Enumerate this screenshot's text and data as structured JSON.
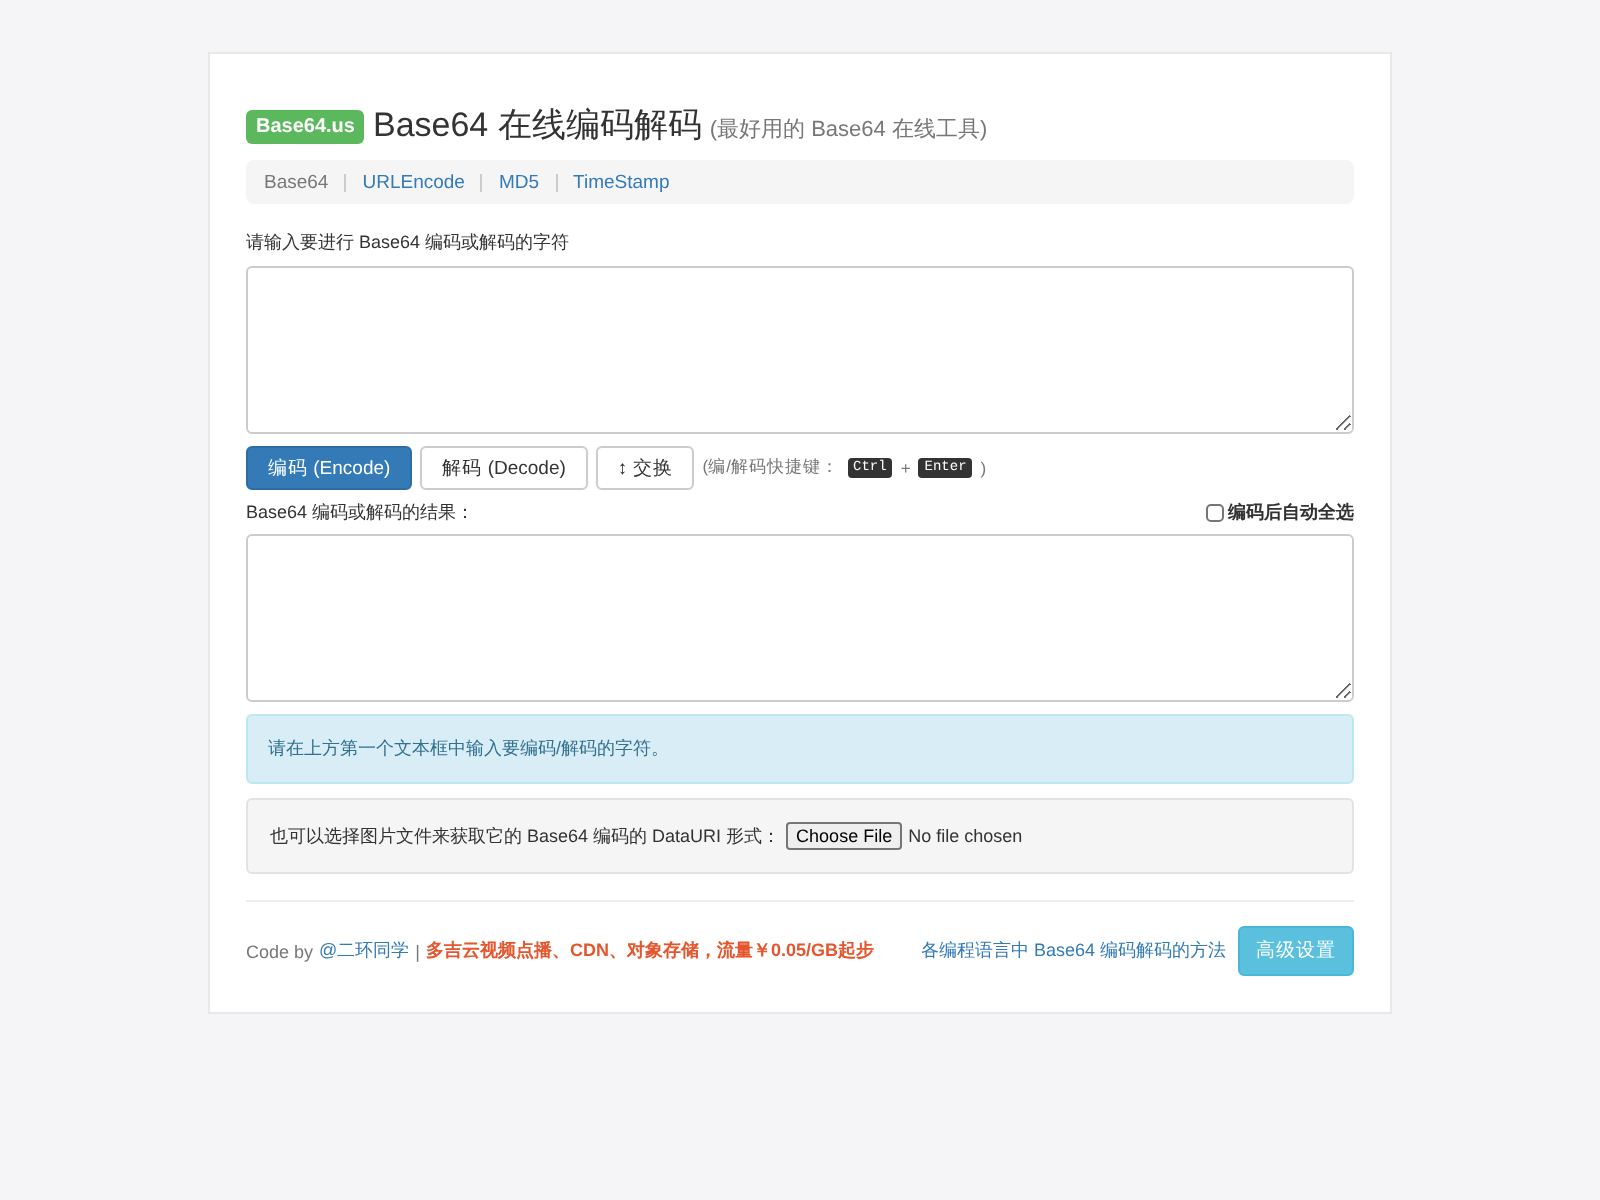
{
  "header": {
    "badge": "Base64.us",
    "title": "Base64 在线编码解码",
    "subtitle": "(最好用的 Base64 在线工具)"
  },
  "nav": [
    {
      "label": "Base64",
      "selected": true
    },
    {
      "label": "URLEncode",
      "selected": false
    },
    {
      "label": "MD5",
      "selected": false
    },
    {
      "label": "TimeStamp",
      "selected": false
    }
  ],
  "input": {
    "label": "请输入要进行 Base64 编码或解码的字符"
  },
  "buttons": [
    {
      "label": "编码 (Encode)",
      "kind": "primary"
    },
    {
      "label": "解码 (Decode)",
      "kind": "default"
    },
    {
      "label": "↕ 交换",
      "kind": "default"
    }
  ],
  "shortcut": {
    "prefix": "(编/解码快捷键：",
    "key1": "Ctrl",
    "plus": "+",
    "key2": "Enter",
    "suffix": ")"
  },
  "result": {
    "label": "Base64 编码或解码的结果：",
    "auto_select": {
      "label": "编码后自动全选",
      "checked": false
    }
  },
  "alert": "请在上方第一个文本框中输入要编码/解码的字符。",
  "file": {
    "label": "也可以选择图片文件来获取它的 Base64 编码的 DataURI 形式：",
    "button": "Choose File",
    "status": "No file chosen"
  },
  "footer": {
    "credit": "Code by",
    "author": "@二环同学",
    "separator": "|",
    "promo": "多吉云视频点播、CDN、对象存储，流量￥0.05/GB起步",
    "methods_link": "各编程语言中 Base64 编码解码的方法",
    "settings_button": "高级设置"
  }
}
